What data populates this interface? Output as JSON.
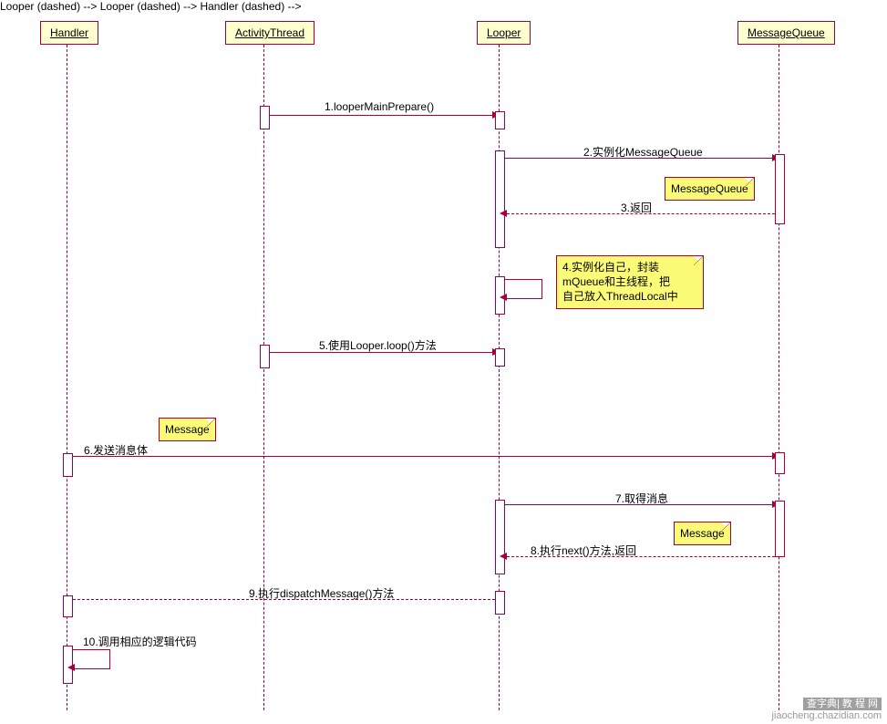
{
  "participants": {
    "handler": "Handler",
    "activityThread": "ActivityThread",
    "looper": "Looper",
    "messageQueue": "MessageQueue"
  },
  "messages": {
    "m1": "1.looperMainPrepare()",
    "m2": "2.实例化MessageQueue",
    "m3": "3.返回",
    "m4": "4.实例化自己，封装\nmQueue和主线程，把\n自己放入ThreadLocal中",
    "m5": "5.使用Looper.loop()方法",
    "m6": "6.发送消息体",
    "m7": "7.取得消息",
    "m8": "8.执行next()方法,返回",
    "m9": "9.执行dispatchMessage()方法",
    "m10": "10.调用相应的逻辑代码"
  },
  "notes": {
    "noteMQ": "MessageQueue",
    "noteMsg1": "Message",
    "noteMsg2": "Message"
  },
  "watermark": {
    "brand": "查字典| 教 程 网",
    "url": "jiaocheng.chazidian.com"
  },
  "chart_data": {
    "type": "sequence-diagram",
    "participants": [
      "Handler",
      "ActivityThread",
      "Looper",
      "MessageQueue"
    ],
    "interactions": [
      {
        "from": "ActivityThread",
        "to": "Looper",
        "label": "1.looperMainPrepare()",
        "kind": "sync"
      },
      {
        "from": "Looper",
        "to": "MessageQueue",
        "label": "2.实例化MessageQueue",
        "kind": "sync"
      },
      {
        "from": "MessageQueue",
        "to": "Looper",
        "label": "3.返回",
        "kind": "return",
        "note": "MessageQueue"
      },
      {
        "from": "Looper",
        "to": "Looper",
        "label": "4.实例化自己，封装mQueue和主线程，把自己放入ThreadLocal中",
        "kind": "self"
      },
      {
        "from": "ActivityThread",
        "to": "Looper",
        "label": "5.使用Looper.loop()方法",
        "kind": "sync"
      },
      {
        "from": "Handler",
        "to": "MessageQueue",
        "label": "6.发送消息体",
        "kind": "sync",
        "note": "Message"
      },
      {
        "from": "Looper",
        "to": "MessageQueue",
        "label": "7.取得消息",
        "kind": "sync"
      },
      {
        "from": "MessageQueue",
        "to": "Looper",
        "label": "8.执行next()方法,返回",
        "kind": "return",
        "note": "Message"
      },
      {
        "from": "Looper",
        "to": "Handler",
        "label": "9.执行dispatchMessage()方法",
        "kind": "return"
      },
      {
        "from": "Handler",
        "to": "Handler",
        "label": "10.调用相应的逻辑代码",
        "kind": "self"
      }
    ]
  }
}
